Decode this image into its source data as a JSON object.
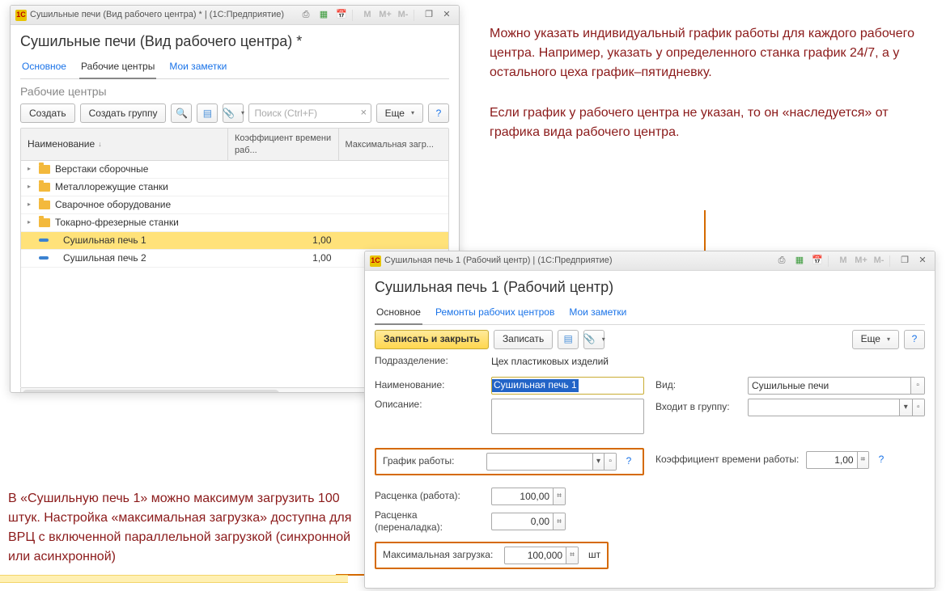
{
  "notes": {
    "right1": "Можно указать индивидуальный график работы для каждого рабочего центра. Например, указать у определенного станка график 24/7, а у остального цеха график–пятидневку.",
    "right2": "Если график у рабочего центра не указан, то он «наследуется» от графика вида рабочего центра.",
    "left": "В «Сушильную печь 1» можно максимум загрузить 100 штук. Настройка «максимальная загрузка» доступна для ВРЦ с включенной параллельной загрузкой (синхронной или асинхронной)"
  },
  "win1": {
    "chrome_title": "Сушильные печи (Вид рабочего центра) * | (1С:Предприятие)",
    "logo": "1C",
    "page_title": "Сушильные печи (Вид рабочего центра) *",
    "tabs": {
      "main": "Основное",
      "centers": "Рабочие центры",
      "notes": "Мои заметки"
    },
    "section": "Рабочие центры",
    "toolbar": {
      "create": "Создать",
      "create_group": "Создать группу",
      "search_placeholder": "Поиск (Ctrl+F)",
      "more": "Еще"
    },
    "table": {
      "headers": {
        "name": "Наименование",
        "coef": "Коэффициент времени раб...",
        "maxload": "Максимальная загр..."
      },
      "rows": [
        {
          "type": "folder",
          "name": "Верстаки сборочные",
          "coef": "",
          "max": ""
        },
        {
          "type": "folder",
          "name": "Металлорежущие станки",
          "coef": "",
          "max": ""
        },
        {
          "type": "folder",
          "name": "Сварочное оборудование",
          "coef": "",
          "max": ""
        },
        {
          "type": "folder",
          "name": "Токарно-фрезерные станки",
          "coef": "",
          "max": ""
        },
        {
          "type": "item",
          "name": "Сушильная печь 1",
          "coef": "1,00",
          "max": "",
          "selected": true
        },
        {
          "type": "item",
          "name": "Сушильная печь 2",
          "coef": "1,00",
          "max": ""
        }
      ]
    }
  },
  "win2": {
    "chrome_title": "Сушильная печь 1 (Рабочий центр) | (1С:Предприятие)",
    "logo": "1C",
    "page_title": "Сушильная печь 1 (Рабочий центр)",
    "tabs": {
      "main": "Основное",
      "repairs": "Ремонты рабочих центров",
      "notes": "Мои заметки"
    },
    "toolbar": {
      "save_close": "Записать и закрыть",
      "save": "Записать",
      "more": "Еще"
    },
    "labels": {
      "department": "Подразделение:",
      "name": "Наименование:",
      "desc": "Описание:",
      "type": "Вид:",
      "group": "Входит в группу:",
      "schedule": "График работы:",
      "coef": "Коэффициент времени работы:",
      "rate_work": "Расценка (работа):",
      "rate_setup": "Расценка (переналадка):",
      "maxload": "Максимальная загрузка:"
    },
    "values": {
      "department": "Цех пластиковых изделий",
      "name": "Сушильная печь 1",
      "desc": "",
      "type": "Сушильные печи",
      "group": "",
      "schedule": "",
      "coef": "1,00",
      "rate_work": "100,00",
      "rate_setup": "0,00",
      "maxload": "100,000",
      "maxload_unit": "шт"
    },
    "help": "?",
    "m": {
      "m": "M",
      "mp": "M+",
      "mm": "M-"
    }
  }
}
